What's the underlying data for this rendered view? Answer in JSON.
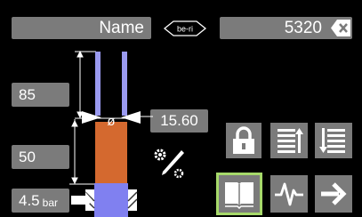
{
  "header": {
    "name_label": "Name",
    "logo_text": "be-ri",
    "order_number": "5320"
  },
  "dimensions": {
    "upper_value": "85",
    "lower_value": "50",
    "pressure_value": "4.5",
    "pressure_unit": "bar",
    "diameter_symbol": "ø",
    "diameter_value": "15.60"
  },
  "icons": {
    "clear": "clear-icon",
    "tool_settings": "tool-settings-icon",
    "lock": "lock-icon",
    "list_up": "list-sort-up-icon",
    "list_down": "list-sort-down-icon",
    "book": "book-icon",
    "waveform": "waveform-icon",
    "next": "arrow-right-icon"
  },
  "colors": {
    "field_bg": "#7b7b7b",
    "tube": "#9a9af0",
    "workpiece": "#d4692f",
    "clamp": "#8080f0",
    "selected": "#a6d96a"
  }
}
